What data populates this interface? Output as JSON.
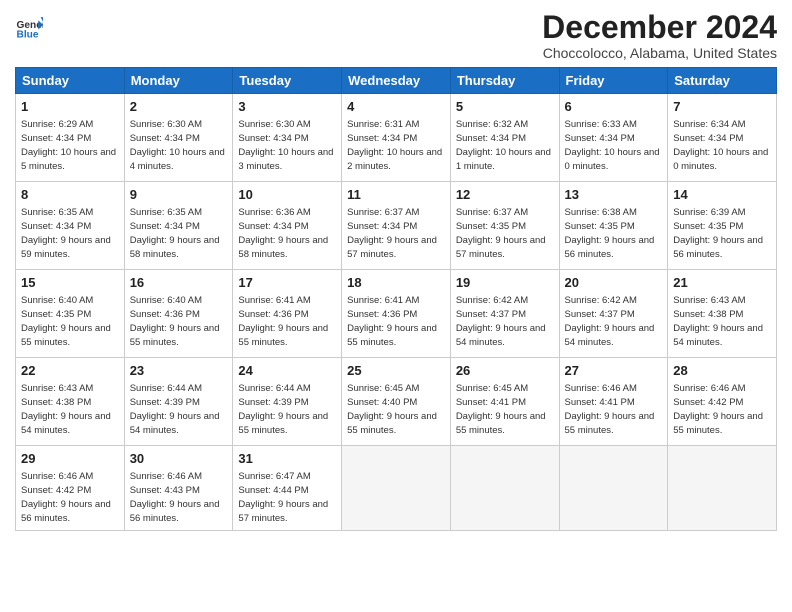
{
  "header": {
    "logo_line1": "General",
    "logo_line2": "Blue",
    "month_title": "December 2024",
    "location": "Choccolocco, Alabama, United States"
  },
  "weekdays": [
    "Sunday",
    "Monday",
    "Tuesday",
    "Wednesday",
    "Thursday",
    "Friday",
    "Saturday"
  ],
  "weeks": [
    [
      {
        "day": "1",
        "sunrise": "6:29 AM",
        "sunset": "4:34 PM",
        "daylight": "10 hours and 5 minutes."
      },
      {
        "day": "2",
        "sunrise": "6:30 AM",
        "sunset": "4:34 PM",
        "daylight": "10 hours and 4 minutes."
      },
      {
        "day": "3",
        "sunrise": "6:30 AM",
        "sunset": "4:34 PM",
        "daylight": "10 hours and 3 minutes."
      },
      {
        "day": "4",
        "sunrise": "6:31 AM",
        "sunset": "4:34 PM",
        "daylight": "10 hours and 2 minutes."
      },
      {
        "day": "5",
        "sunrise": "6:32 AM",
        "sunset": "4:34 PM",
        "daylight": "10 hours and 1 minute."
      },
      {
        "day": "6",
        "sunrise": "6:33 AM",
        "sunset": "4:34 PM",
        "daylight": "10 hours and 0 minutes."
      },
      {
        "day": "7",
        "sunrise": "6:34 AM",
        "sunset": "4:34 PM",
        "daylight": "10 hours and 0 minutes."
      }
    ],
    [
      {
        "day": "8",
        "sunrise": "6:35 AM",
        "sunset": "4:34 PM",
        "daylight": "9 hours and 59 minutes."
      },
      {
        "day": "9",
        "sunrise": "6:35 AM",
        "sunset": "4:34 PM",
        "daylight": "9 hours and 58 minutes."
      },
      {
        "day": "10",
        "sunrise": "6:36 AM",
        "sunset": "4:34 PM",
        "daylight": "9 hours and 58 minutes."
      },
      {
        "day": "11",
        "sunrise": "6:37 AM",
        "sunset": "4:34 PM",
        "daylight": "9 hours and 57 minutes."
      },
      {
        "day": "12",
        "sunrise": "6:37 AM",
        "sunset": "4:35 PM",
        "daylight": "9 hours and 57 minutes."
      },
      {
        "day": "13",
        "sunrise": "6:38 AM",
        "sunset": "4:35 PM",
        "daylight": "9 hours and 56 minutes."
      },
      {
        "day": "14",
        "sunrise": "6:39 AM",
        "sunset": "4:35 PM",
        "daylight": "9 hours and 56 minutes."
      }
    ],
    [
      {
        "day": "15",
        "sunrise": "6:40 AM",
        "sunset": "4:35 PM",
        "daylight": "9 hours and 55 minutes."
      },
      {
        "day": "16",
        "sunrise": "6:40 AM",
        "sunset": "4:36 PM",
        "daylight": "9 hours and 55 minutes."
      },
      {
        "day": "17",
        "sunrise": "6:41 AM",
        "sunset": "4:36 PM",
        "daylight": "9 hours and 55 minutes."
      },
      {
        "day": "18",
        "sunrise": "6:41 AM",
        "sunset": "4:36 PM",
        "daylight": "9 hours and 55 minutes."
      },
      {
        "day": "19",
        "sunrise": "6:42 AM",
        "sunset": "4:37 PM",
        "daylight": "9 hours and 54 minutes."
      },
      {
        "day": "20",
        "sunrise": "6:42 AM",
        "sunset": "4:37 PM",
        "daylight": "9 hours and 54 minutes."
      },
      {
        "day": "21",
        "sunrise": "6:43 AM",
        "sunset": "4:38 PM",
        "daylight": "9 hours and 54 minutes."
      }
    ],
    [
      {
        "day": "22",
        "sunrise": "6:43 AM",
        "sunset": "4:38 PM",
        "daylight": "9 hours and 54 minutes."
      },
      {
        "day": "23",
        "sunrise": "6:44 AM",
        "sunset": "4:39 PM",
        "daylight": "9 hours and 54 minutes."
      },
      {
        "day": "24",
        "sunrise": "6:44 AM",
        "sunset": "4:39 PM",
        "daylight": "9 hours and 55 minutes."
      },
      {
        "day": "25",
        "sunrise": "6:45 AM",
        "sunset": "4:40 PM",
        "daylight": "9 hours and 55 minutes."
      },
      {
        "day": "26",
        "sunrise": "6:45 AM",
        "sunset": "4:41 PM",
        "daylight": "9 hours and 55 minutes."
      },
      {
        "day": "27",
        "sunrise": "6:46 AM",
        "sunset": "4:41 PM",
        "daylight": "9 hours and 55 minutes."
      },
      {
        "day": "28",
        "sunrise": "6:46 AM",
        "sunset": "4:42 PM",
        "daylight": "9 hours and 55 minutes."
      }
    ],
    [
      {
        "day": "29",
        "sunrise": "6:46 AM",
        "sunset": "4:42 PM",
        "daylight": "9 hours and 56 minutes."
      },
      {
        "day": "30",
        "sunrise": "6:46 AM",
        "sunset": "4:43 PM",
        "daylight": "9 hours and 56 minutes."
      },
      {
        "day": "31",
        "sunrise": "6:47 AM",
        "sunset": "4:44 PM",
        "daylight": "9 hours and 57 minutes."
      },
      null,
      null,
      null,
      null
    ]
  ]
}
